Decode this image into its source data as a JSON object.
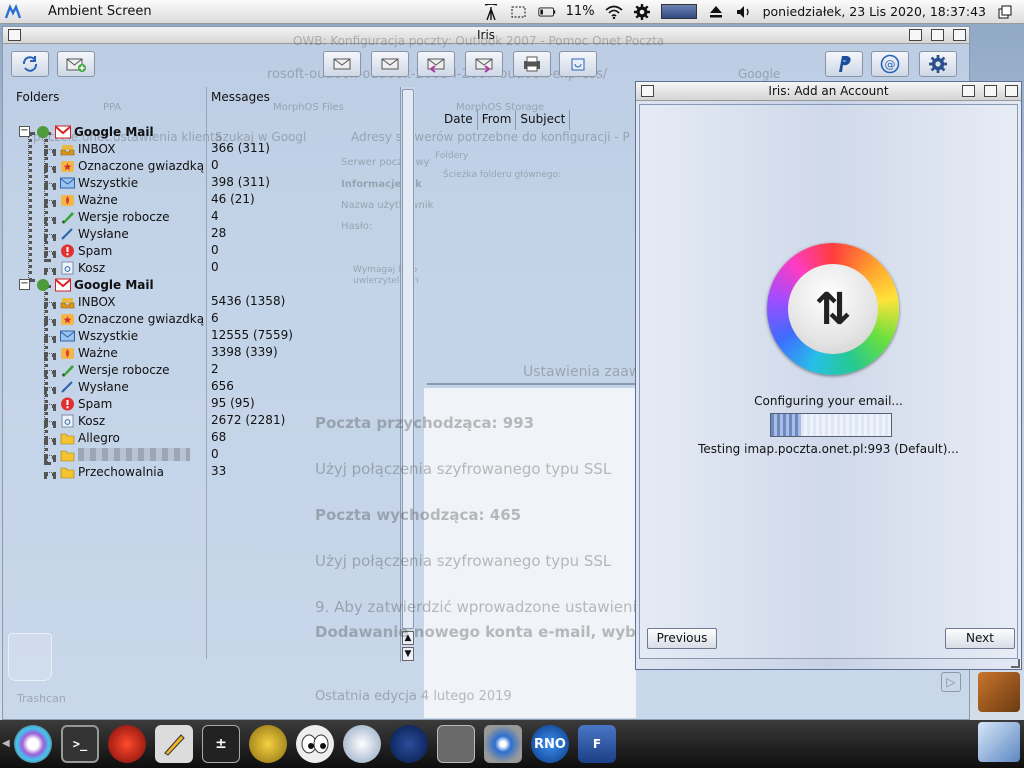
{
  "menubar": {
    "app_title": "Ambient Screen",
    "battery": "11%",
    "clock": "poniedziałek, 23 Lis 2020, 18:37:43"
  },
  "main_window": {
    "title": "Iris",
    "ghost_titles": {
      "browser_title": "OWB: Konfiguracja poczty: Outlook 2007 - Pomoc Onet Poczta",
      "url": "rosoft-outlook-outlook-2003-i-2007-outlook-express/",
      "search": "Google",
      "tabs": [
        "poczcie.onet.ustawienia klienta",
        "Szukaj w Googl",
        "Adresy serwerów potrzebne do konfiguracji - P"
      ],
      "bookmarks": [
        "PPA",
        "MorphOS Files",
        "MorphOS Storage"
      ],
      "form": [
        "Serwer poczty wy",
        "Informacje o k",
        "Nazwa użytkownik",
        "Hasło:",
        "Foldery",
        "Ścieżka folderu głównego:",
        "Wymagaj logo",
        "uwierzytelnian",
        "Ustawienia zaaw",
        "Trashcan"
      ]
    },
    "folders_header": "Folders",
    "messages_header": "Messages",
    "message_columns": [
      "Date",
      "From",
      "Subject"
    ],
    "accounts": [
      {
        "name": "Google Mail",
        "folders": [
          {
            "label": "INBOX",
            "count": "366 (311)",
            "icon": "inbox-icon"
          },
          {
            "label": "Oznaczone gwiazdką",
            "count": "0",
            "icon": "starred-icon"
          },
          {
            "label": "Wszystkie",
            "count": "398 (311)",
            "icon": "all-mail-icon"
          },
          {
            "label": "Ważne",
            "count": "46 (21)",
            "icon": "important-icon"
          },
          {
            "label": "Wersje robocze",
            "count": "4",
            "icon": "drafts-icon"
          },
          {
            "label": "Wysłane",
            "count": "28",
            "icon": "sent-icon"
          },
          {
            "label": "Spam",
            "count": "0",
            "icon": "spam-icon"
          },
          {
            "label": "Kosz",
            "count": "0",
            "icon": "trash-icon"
          }
        ]
      },
      {
        "name": "Google Mail",
        "folders": [
          {
            "label": "INBOX",
            "count": "5436 (1358)",
            "icon": "inbox-icon"
          },
          {
            "label": "Oznaczone gwiazdką",
            "count": "6",
            "icon": "starred-icon"
          },
          {
            "label": "Wszystkie",
            "count": "12555 (7559)",
            "icon": "all-mail-icon"
          },
          {
            "label": "Ważne",
            "count": "3398 (339)",
            "icon": "important-icon"
          },
          {
            "label": "Wersje robocze",
            "count": "2",
            "icon": "drafts-icon"
          },
          {
            "label": "Wysłane",
            "count": "656",
            "icon": "sent-icon"
          },
          {
            "label": "Spam",
            "count": "95 (95)",
            "icon": "spam-icon"
          },
          {
            "label": "Kosz",
            "count": "2672 (2281)",
            "icon": "trash-icon"
          },
          {
            "label": "Allegro",
            "count": "68",
            "icon": "folder-icon"
          },
          {
            "label": "",
            "count": "0",
            "icon": "folder-icon",
            "redacted": true
          },
          {
            "label": "Przechowalnia",
            "count": "33",
            "icon": "folder-icon"
          }
        ]
      }
    ],
    "article": [
      "Poczta przychodząca: 993",
      "Użyj połączenia szyfrowanego typu SSL",
      "Poczta wychodząca: 465",
      "Użyj połączenia szyfrowanego typu SSL",
      "9. Aby zatwierdzić wprowadzone ustawienia k",
      "Dodawanie nowego konta e-mail, wybierz Da",
      "Ostatnia edycja 4 lutego 2019"
    ]
  },
  "dialog": {
    "title": "Iris: Add an Account",
    "status": "Configuring your email...",
    "detail": "Testing imap.poczta.onet.pl:993 (Default)...",
    "progress": 0.25,
    "previous_label": "Previous",
    "next_label": "Next"
  },
  "colors": {
    "accent": "#5d7096",
    "spam": "#e03030",
    "folder": "#f4c430"
  }
}
